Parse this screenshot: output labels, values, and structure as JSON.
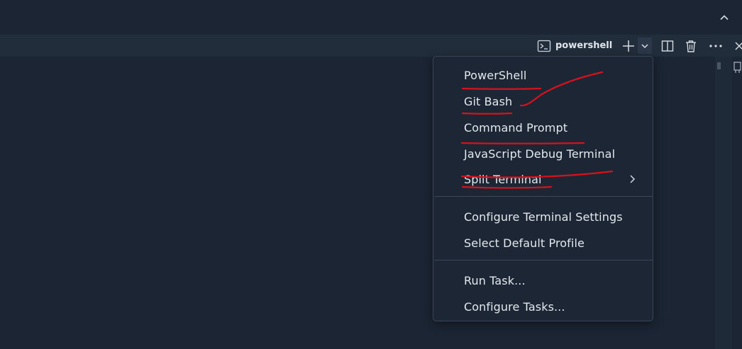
{
  "terminal": {
    "active_profile": "powershell"
  },
  "icons": {
    "collapse": "chevron-up-icon",
    "terminal": "terminal-icon",
    "add": "plus-icon",
    "dropdown": "chevron-down-icon",
    "split": "split-editor-icon",
    "trash": "trash-icon",
    "more": "ellipsis-icon",
    "close": "close-icon"
  },
  "menu": {
    "profiles": [
      {
        "label": "PowerShell"
      },
      {
        "label": "Git Bash"
      },
      {
        "label": "Command Prompt"
      },
      {
        "label": "JavaScript Debug Terminal"
      },
      {
        "label": "Split Terminal"
      }
    ],
    "settings": [
      {
        "label": "Configure Terminal Settings"
      },
      {
        "label": "Select Default Profile"
      }
    ],
    "tasks": [
      {
        "label": "Run Task..."
      },
      {
        "label": "Configure Tasks..."
      }
    ]
  },
  "colors": {
    "background": "#1b2533",
    "header": "#222d3b",
    "menu_background": "#1c2634",
    "annotation": "#d8121c"
  }
}
